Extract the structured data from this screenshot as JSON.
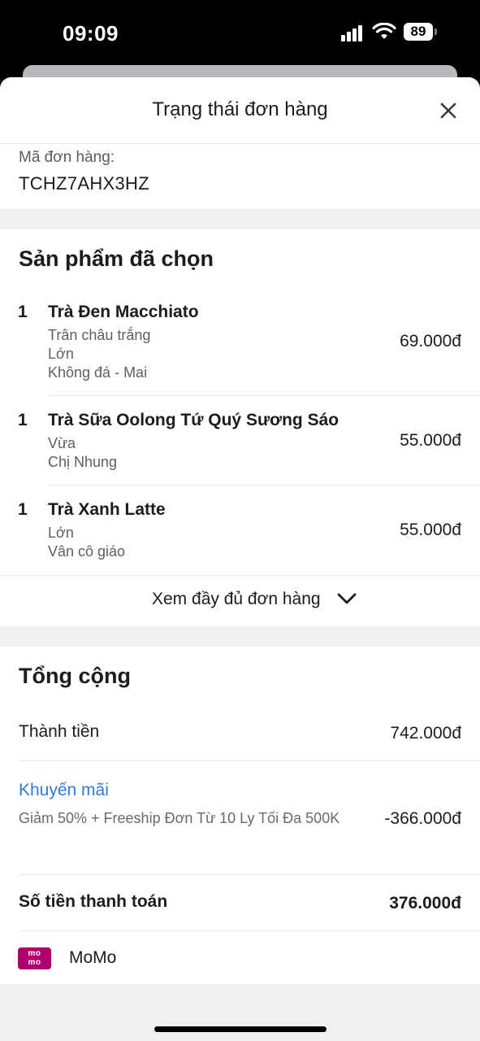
{
  "status_bar": {
    "time": "09:09",
    "battery": "89"
  },
  "header": {
    "title": "Trạng thái đơn hàng",
    "close_icon": "close-icon"
  },
  "order": {
    "code_label": "Mã đơn hàng:",
    "code_value": "TCHZ7AHX3HZ"
  },
  "products": {
    "title": "Sản phẩm đã chọn",
    "items": [
      {
        "qty": "1",
        "name": "Trà Đen Macchiato",
        "options": [
          "Trân châu trắng",
          "Lớn",
          "Không đá - Mai"
        ],
        "price": "69.000đ"
      },
      {
        "qty": "1",
        "name": "Trà Sữa Oolong Tứ Quý Sương Sáo",
        "options": [
          "Vừa",
          "Chị Nhung"
        ],
        "price": "55.000đ"
      },
      {
        "qty": "1",
        "name": "Trà Xanh Latte",
        "options": [
          "Lớn",
          "Vân cô giáo"
        ],
        "price": "55.000đ"
      }
    ],
    "expand_label": "Xem đầy đủ đơn hàng"
  },
  "totals": {
    "title": "Tổng cộng",
    "subtotal_label": "Thành tiền",
    "subtotal_value": "742.000đ",
    "promo_label": "Khuyến mãi",
    "promo_desc": "Giảm 50% + Freeship Đơn Từ 10 Ly Tối Đa 500K",
    "promo_value": "-366.000đ",
    "payable_label": "Số tiền thanh toán",
    "payable_value": "376.000đ",
    "payment_logo_top": "mo",
    "payment_logo_bottom": "mo",
    "payment_method": "MoMo"
  },
  "colors": {
    "link": "#2f7bd6",
    "momo_brand": "#b0006d",
    "background": "#f0f0f2"
  }
}
